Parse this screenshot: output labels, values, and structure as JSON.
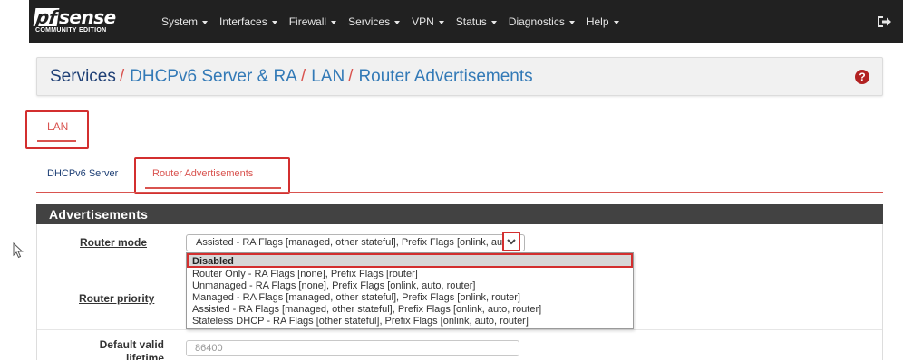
{
  "navbar": {
    "logo_text": "sense",
    "logo_prefix": "pf",
    "logo_subtitle": "COMMUNITY EDITION",
    "menu": [
      {
        "label": "System"
      },
      {
        "label": "Interfaces"
      },
      {
        "label": "Firewall"
      },
      {
        "label": "Services"
      },
      {
        "label": "VPN"
      },
      {
        "label": "Status"
      },
      {
        "label": "Diagnostics"
      },
      {
        "label": "Help"
      }
    ],
    "logout_icon": "sign-out-icon"
  },
  "breadcrumb": {
    "part1": "Services",
    "sep1": "/",
    "part2": "DHCPv6 Server & RA",
    "sep2": "/",
    "part3": "LAN",
    "sep3": "/",
    "part4": "Router Advertisements",
    "help_icon": "question-circle-icon",
    "help_glyph": "?"
  },
  "tabs": {
    "interface_tab": "LAN",
    "subtabs": [
      {
        "label": "DHCPv6 Server"
      },
      {
        "label": "Router Advertisements"
      }
    ]
  },
  "section": {
    "title": "Advertisements",
    "router_mode_label": "Router mode",
    "router_mode_value": "Assisted - RA Flags [managed, other stateful], Prefix Flags [onlink, auto, router]",
    "router_priority_label": "Router priority",
    "default_valid_label": "Default valid lifetime",
    "default_valid_value": "86400"
  },
  "dropdown": {
    "options": [
      "Disabled",
      "Router Only - RA Flags [none], Prefix Flags [router]",
      "Unmanaged - RA Flags [none], Prefix Flags [onlink, auto, router]",
      "Managed - RA Flags [managed, other stateful], Prefix Flags [onlink, router]",
      "Assisted - RA Flags [managed, other stateful], Prefix Flags [onlink, auto, router]",
      "Stateless DHCP - RA Flags [other stateful], Prefix Flags [onlink, auto, router]"
    ],
    "highlighted": "Disabled"
  },
  "colors": {
    "navbar_bg": "#212121",
    "accent_red": "#d9534f",
    "highlight_red": "#d32f2f",
    "link_blue": "#337ab7",
    "section_header": "#424242"
  }
}
